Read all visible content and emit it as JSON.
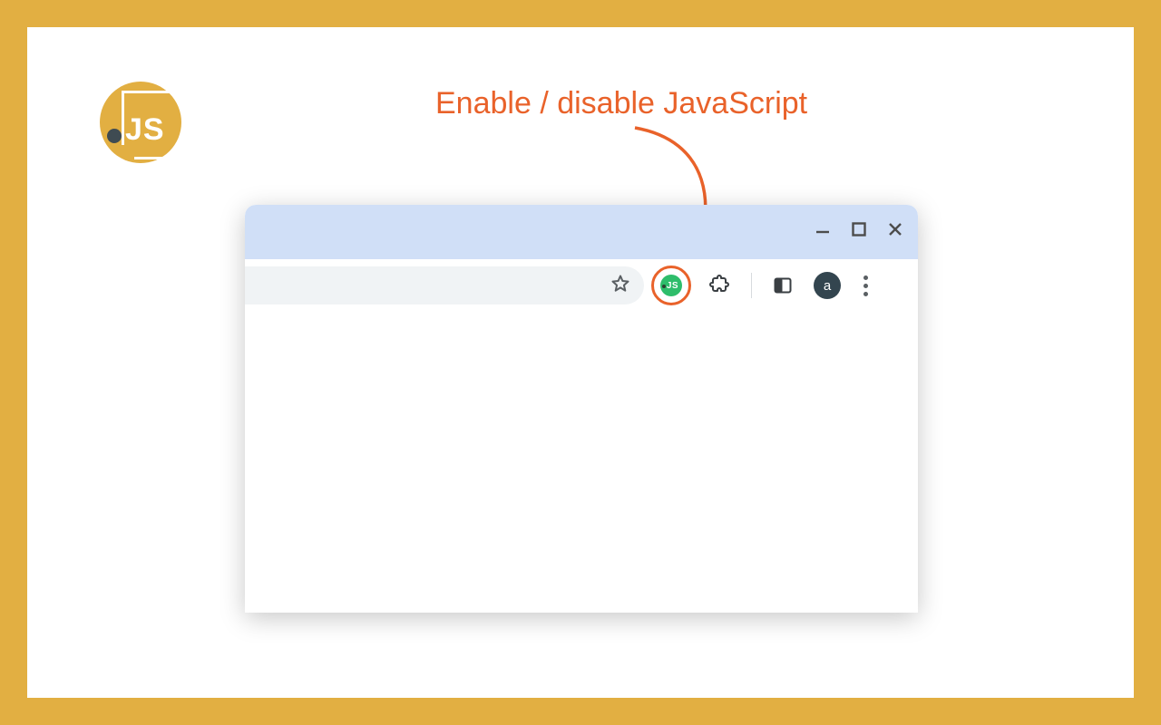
{
  "annotation": {
    "label": "Enable / disable JavaScript"
  },
  "logo": {
    "text": "JS"
  },
  "browser": {
    "window_controls": {
      "minimize": "minimize",
      "maximize": "maximize",
      "close": "close"
    },
    "omnibox": {
      "value": ""
    },
    "extension": {
      "name": "JS",
      "enabled_color": "#2ebd6b"
    },
    "profile": {
      "initial": "a"
    }
  },
  "colors": {
    "frame": "#e2af42",
    "annotation": "#e9622a",
    "titlebar": "#d0dff7"
  }
}
